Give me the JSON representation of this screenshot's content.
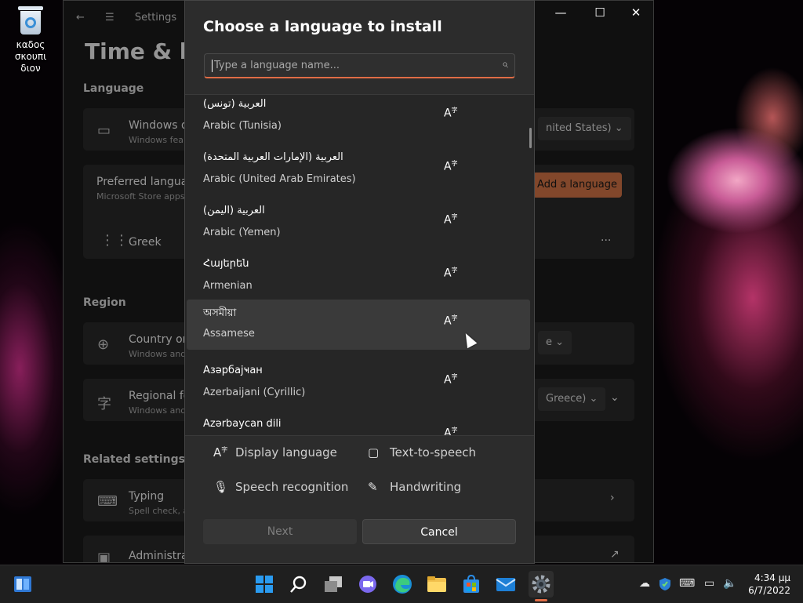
{
  "desktop": {
    "recycle_bin_label_line1": "καδος σκουπι",
    "recycle_bin_label_line2": "διον"
  },
  "settings": {
    "back_glyph": "←",
    "menu_glyph": "☰",
    "app_title": "Settings",
    "page_title": "Time & lar",
    "section_language": "Language",
    "windows_display": "Windows di",
    "windows_display_sub": "Windows fea",
    "windows_display_value": "nited States)",
    "preferred_languages": "Preferred language",
    "preferred_languages_sub": "Microsoft Store apps",
    "add_language": "Add a language",
    "greek": "Greek",
    "more": "···",
    "section_region": "Region",
    "country": "Country or",
    "country_sub": "Windows and",
    "country_value": "e",
    "regional_format": "Regional fo",
    "regional_format_sub": "Windows and",
    "regional_value": "Greece)",
    "section_related": "Related settings",
    "typing": "Typing",
    "typing_sub": "Spell check, a",
    "admin": "Administrat",
    "minimize": "—",
    "maximize": "☐",
    "close": "✕"
  },
  "dialog": {
    "title": "Choose a language to install",
    "search_placeholder": "Type a language name...",
    "languages": [
      {
        "native": "العربية (تونس)",
        "english": "Arabic (Tunisia)"
      },
      {
        "native": "العربية (الإمارات العربية المتحدة)",
        "english": "Arabic (United Arab Emirates)"
      },
      {
        "native": "العربية (اليمن)",
        "english": "Arabic (Yemen)"
      },
      {
        "native": "Հայերեն",
        "english": "Armenian"
      },
      {
        "native": "অসমীয়া",
        "english": "Assamese"
      },
      {
        "native": "Азәрбајҹан",
        "english": "Azerbaijani (Cyrillic)"
      },
      {
        "native": "Azərbaycan dili",
        "english": ""
      }
    ],
    "features": {
      "display_language": "Display language",
      "text_to_speech": "Text-to-speech",
      "speech_recognition": "Speech recognition",
      "handwriting": "Handwriting"
    },
    "next": "Next",
    "cancel": "Cancel"
  },
  "taskbar": {
    "time": "4:34 μμ",
    "date": "6/7/2022"
  },
  "colors": {
    "accent": "#e06c45",
    "taskbar": "#1f1f1f",
    "dialog": "#2c2c2c"
  }
}
